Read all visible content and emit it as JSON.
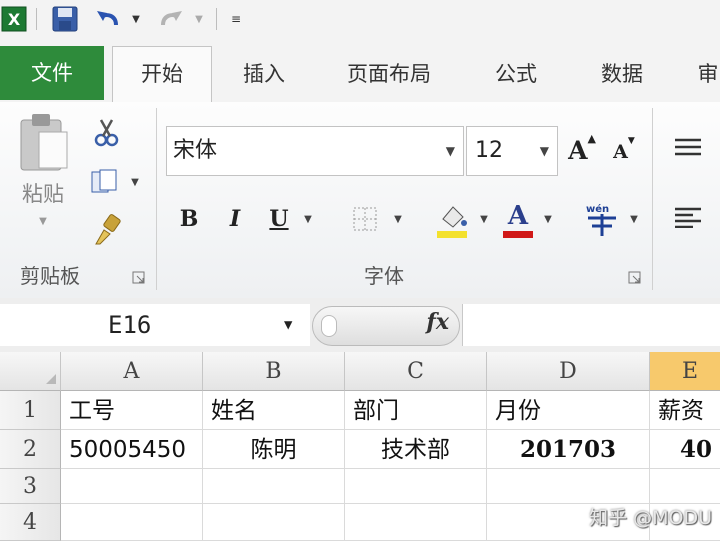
{
  "ribbon_tabs": [
    {
      "label": "文件",
      "active": false
    },
    {
      "label": "开始",
      "active": true
    },
    {
      "label": "插入",
      "active": false
    },
    {
      "label": "页面布局",
      "active": false
    },
    {
      "label": "公式",
      "active": false
    },
    {
      "label": "数据",
      "active": false
    },
    {
      "label": "审",
      "active": false
    }
  ],
  "clipboard": {
    "paste_label": "粘贴",
    "group_label": "剪贴板"
  },
  "font": {
    "name": "宋体",
    "size": "12",
    "group_label": "字体",
    "bold": "B",
    "italic": "I",
    "underline": "U",
    "font_color_glyph": "A"
  },
  "formula_bar": {
    "name_box": "E16",
    "fx": "fx",
    "formula": ""
  },
  "sheet": {
    "columns": [
      "A",
      "B",
      "C",
      "D",
      "E"
    ],
    "rows": [
      {
        "row": "1",
        "cells": [
          "工号",
          "姓名",
          "部门",
          "月份",
          "薪资"
        ]
      },
      {
        "row": "2",
        "cells": [
          "50005450",
          "陈明",
          "技术部",
          "201703",
          "40"
        ]
      },
      {
        "row": "3",
        "cells": [
          "",
          "",
          "",
          "",
          ""
        ]
      },
      {
        "row": "4",
        "cells": [
          "",
          "",
          "",
          "",
          ""
        ]
      }
    ]
  },
  "watermark": "知乎 @MODU",
  "colors": {
    "file_tab": "#2e8b3b",
    "selected_column": "#f7c96c",
    "excel_icon": "#1d7a33",
    "font_color_red": "#d01818",
    "highlight_yellow": "#f3e12e"
  }
}
